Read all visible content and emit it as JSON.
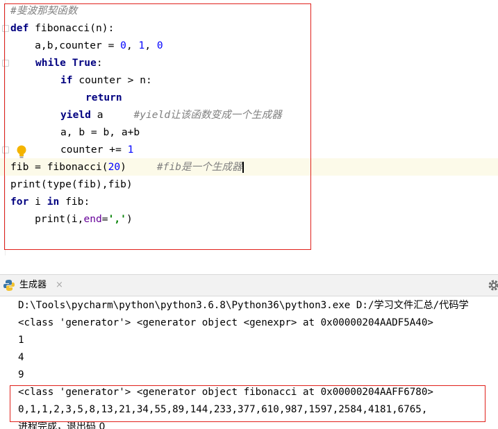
{
  "editor": {
    "lines": [
      {
        "comment": "#斐波那契函数"
      },
      {
        "kw_def": "def",
        "rest": " fibonacci(n):"
      },
      {
        "pre": "    a,b,counter = ",
        "n0": "0",
        "c1": ", ",
        "n1": "1",
        "c2": ", ",
        "n2": "0"
      },
      {
        "kw_while": "while",
        "kw_true": "True",
        "colon": ":"
      },
      {
        "kw_if": "if",
        "rest": " counter > n:"
      },
      {
        "kw_return": "return"
      },
      {
        "kw_yield": "yield",
        "rest": " a     ",
        "comment": "#yield让该函数变成一个生成器"
      },
      {
        "text": "a, b = b, a+b"
      },
      {
        "pre": "counter += ",
        "num": "1"
      },
      {
        "pre": "fib = fibonacci(",
        "num": "20",
        "post": ")     ",
        "comment": "#fib是一个生成器"
      },
      {
        "text": "print(type(fib),fib)"
      },
      {
        "kw_for": "for",
        "mid": " i ",
        "kw_in": "in",
        "rest": " fib:"
      },
      {
        "pre": "    print(i,",
        "kwarg": "end",
        "eq": "=",
        "str": "','",
        "post": ")"
      }
    ]
  },
  "run_panel": {
    "tab_label": "生成器",
    "tab_close": "×",
    "icons": {
      "tab": "python-icon",
      "settings": "gear-icon"
    }
  },
  "console": {
    "lines": [
      "D:\\Tools\\pycharm\\python\\python3.6.8\\Python36\\python3.exe D:/学习文件汇总/代码学",
      "<class 'generator'> <generator object <genexpr> at 0x00000204AADF5A40>",
      "1",
      "4",
      "9",
      "<class 'generator'> <generator object fibonacci at 0x00000204AAFF6780>",
      "0,1,1,2,3,5,8,13,21,34,55,89,144,233,377,610,987,1597,2584,4181,6765,",
      "进程完成，退出码 0"
    ]
  },
  "colors": {
    "keyword": "#000080",
    "number": "#0000ff",
    "string": "#008000",
    "kwarg": "#660099",
    "comment": "#808080",
    "highlight_box": "#e0201a",
    "current_line": "#fcfae9"
  }
}
